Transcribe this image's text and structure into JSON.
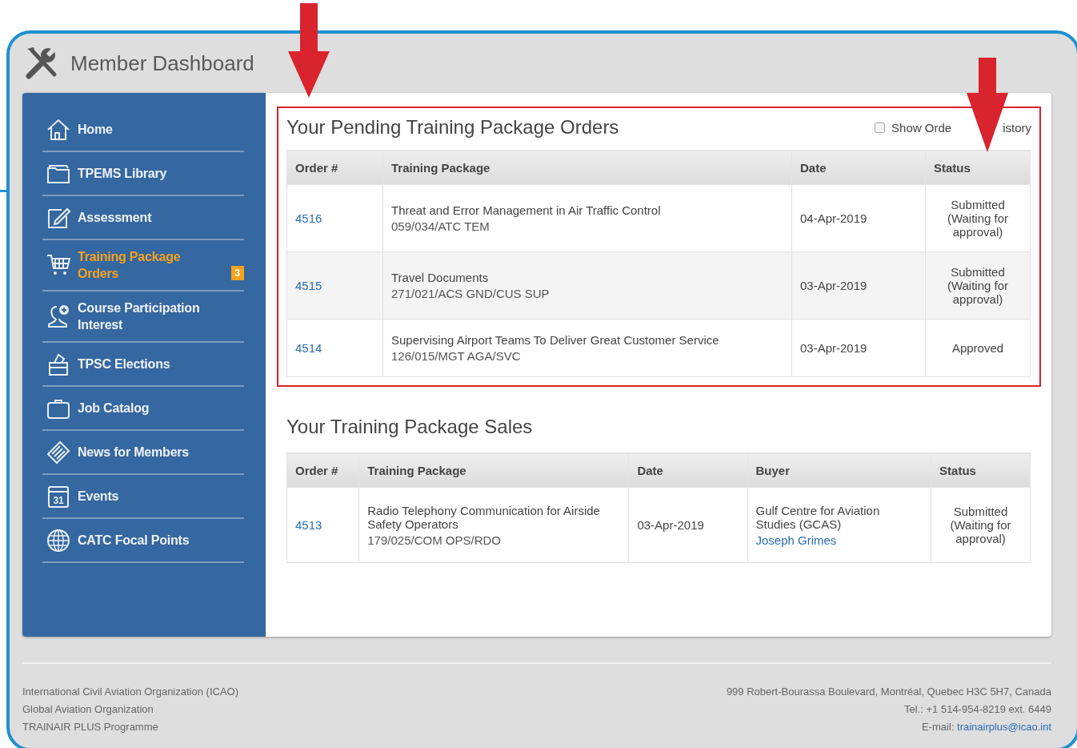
{
  "header": {
    "title": "Member Dashboard"
  },
  "sidebar": {
    "items": [
      {
        "label": "Home",
        "kind": "home",
        "selected": false
      },
      {
        "label": "TPEMS Library",
        "kind": "folder",
        "selected": false
      },
      {
        "label": "Assessment",
        "kind": "edit",
        "selected": false
      },
      {
        "label": "Training Package Orders",
        "kind": "cart",
        "selected": true,
        "badge": "3"
      },
      {
        "label": "Course Participation Interest",
        "kind": "person",
        "selected": false
      },
      {
        "label": "TPSC Elections",
        "kind": "ballot",
        "selected": false
      },
      {
        "label": "Job Catalog",
        "kind": "briefcase",
        "selected": false
      },
      {
        "label": "News for Members",
        "kind": "newspaper",
        "selected": false
      },
      {
        "label": "Events",
        "kind": "calendar",
        "icon_text": "31",
        "selected": false
      },
      {
        "label": "CATC Focal Points",
        "kind": "globe",
        "selected": false
      }
    ]
  },
  "pending_orders": {
    "title": "Your Pending Training Package Orders",
    "show_history": {
      "checked": false,
      "label_parts": [
        "Show Orde",
        "istory"
      ]
    },
    "columns": [
      "Order #",
      "Training Package",
      "Date",
      "Status"
    ],
    "rows": [
      {
        "order": "4516",
        "package": "Threat and Error Management in Air Traffic Control",
        "code": "059/034/ATC TEM",
        "date": "04-Apr-2019",
        "status": "Submitted (Waiting for approval)"
      },
      {
        "order": "4515",
        "package": "Travel Documents",
        "code": "271/021/ACS GND/CUS SUP",
        "date": "03-Apr-2019",
        "status": "Submitted (Waiting for approval)"
      },
      {
        "order": "4514",
        "package": "Supervising Airport Teams To Deliver Great Customer Service",
        "code": "126/015/MGT AGA/SVC",
        "date": "03-Apr-2019",
        "status": "Approved"
      }
    ]
  },
  "sales": {
    "title": "Your Training Package Sales",
    "columns": [
      "Order #",
      "Training Package",
      "Date",
      "Buyer",
      "Status"
    ],
    "rows": [
      {
        "order": "4513",
        "package": "Radio Telephony Communication for Airside Safety Operators",
        "code": "179/025/COM OPS/RDO",
        "date": "03-Apr-2019",
        "buyer": "Gulf Centre for Aviation Studies (GCAS)",
        "buyer_contact": "Joseph Grimes",
        "status": "Submitted (Waiting for approval)"
      }
    ]
  },
  "footer": {
    "left": [
      "International Civil Aviation Organization (ICAO)",
      "Global Aviation Organization",
      "TRAINAIR PLUS Programme"
    ],
    "right": [
      "999 Robert-Bourassa Boulevard, Montréal, Quebec H3C 5H7, Canada",
      "Tel.: +1 514-954-8219 ext. 6449"
    ],
    "email_label": "E-mail:",
    "email": "trainairplus@icao.int"
  }
}
